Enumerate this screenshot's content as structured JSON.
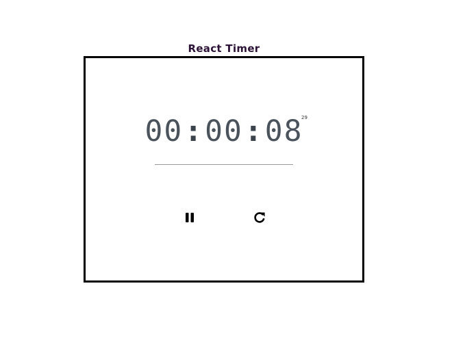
{
  "app": {
    "title": "React Timer"
  },
  "timer": {
    "hours": "00",
    "minutes": "00",
    "seconds": "08",
    "separator": ":",
    "centiseconds": "29"
  },
  "controls": {
    "pause_icon": "pause-icon",
    "reset_icon": "reset-icon"
  }
}
